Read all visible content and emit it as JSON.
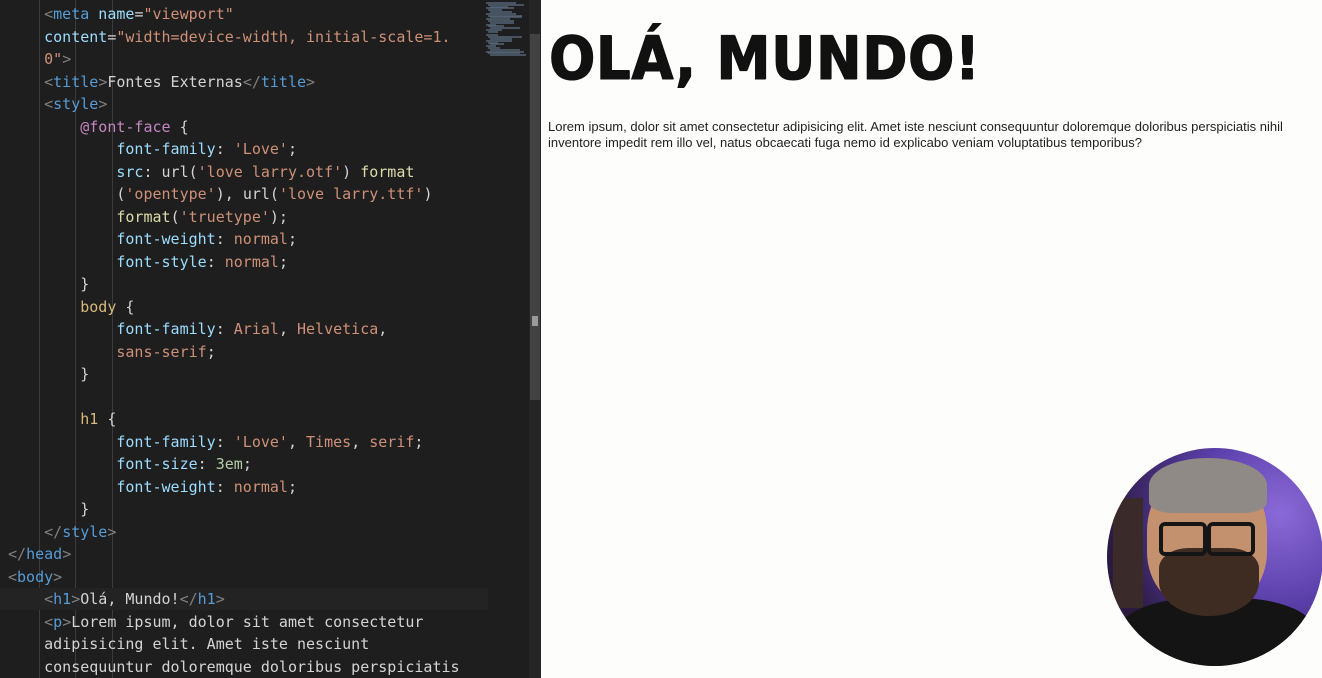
{
  "editor": {
    "lines": [
      [
        [
          "    ",
          "t-txt"
        ],
        [
          "<",
          "t-punc"
        ],
        [
          "meta",
          "t-tag"
        ],
        [
          " name",
          "t-attr"
        ],
        [
          "=",
          "t-txt"
        ],
        [
          "\"viewport\"",
          "t-str"
        ]
      ],
      [
        [
          "    ",
          "t-txt"
        ],
        [
          "content",
          "t-attr"
        ],
        [
          "=",
          "t-txt"
        ],
        [
          "\"width=device-width, initial-scale=1.",
          "t-str"
        ]
      ],
      [
        [
          "    ",
          "t-txt"
        ],
        [
          "0\"",
          "t-str"
        ],
        [
          ">",
          "t-punc"
        ]
      ],
      [
        [
          "    ",
          "t-txt"
        ],
        [
          "<",
          "t-punc"
        ],
        [
          "title",
          "t-tag"
        ],
        [
          ">",
          "t-punc"
        ],
        [
          "Fontes Externas",
          "t-txt"
        ],
        [
          "</",
          "t-punc"
        ],
        [
          "title",
          "t-tag"
        ],
        [
          ">",
          "t-punc"
        ]
      ],
      [
        [
          "    ",
          "t-txt"
        ],
        [
          "<",
          "t-punc"
        ],
        [
          "style",
          "t-tag"
        ],
        [
          ">",
          "t-punc"
        ]
      ],
      [
        [
          "        ",
          "t-txt"
        ],
        [
          "@font-face",
          "t-at"
        ],
        [
          " {",
          "t-txt"
        ]
      ],
      [
        [
          "            ",
          "t-txt"
        ],
        [
          "font-family",
          "t-prop"
        ],
        [
          ": ",
          "t-txt"
        ],
        [
          "'Love'",
          "t-str"
        ],
        [
          ";",
          "t-txt"
        ]
      ],
      [
        [
          "            ",
          "t-txt"
        ],
        [
          "src",
          "t-prop"
        ],
        [
          ": ",
          "t-txt"
        ],
        [
          "url(",
          "t-txt"
        ],
        [
          "'love larry.otf'",
          "t-str"
        ],
        [
          ") ",
          "t-txt"
        ],
        [
          "format",
          "t-fn"
        ]
      ],
      [
        [
          "            ",
          "t-txt"
        ],
        [
          "(",
          "t-txt"
        ],
        [
          "'opentype'",
          "t-str"
        ],
        [
          "), ",
          "t-txt"
        ],
        [
          "url(",
          "t-txt"
        ],
        [
          "'love larry.ttf'",
          "t-str"
        ],
        [
          ")",
          "t-txt"
        ]
      ],
      [
        [
          "            ",
          "t-txt"
        ],
        [
          "format",
          "t-fn"
        ],
        [
          "(",
          "t-txt"
        ],
        [
          "'truetype'",
          "t-str"
        ],
        [
          ");",
          "t-txt"
        ]
      ],
      [
        [
          "            ",
          "t-txt"
        ],
        [
          "font-weight",
          "t-prop"
        ],
        [
          ": ",
          "t-txt"
        ],
        [
          "normal",
          "t-str"
        ],
        [
          ";",
          "t-txt"
        ]
      ],
      [
        [
          "            ",
          "t-txt"
        ],
        [
          "font-style",
          "t-prop"
        ],
        [
          ": ",
          "t-txt"
        ],
        [
          "normal",
          "t-str"
        ],
        [
          ";",
          "t-txt"
        ]
      ],
      [
        [
          "        ",
          "t-txt"
        ],
        [
          "}",
          "t-txt"
        ]
      ],
      [
        [
          "        ",
          "t-txt"
        ],
        [
          "body",
          "t-sel"
        ],
        [
          " {",
          "t-txt"
        ]
      ],
      [
        [
          "            ",
          "t-txt"
        ],
        [
          "font-family",
          "t-prop"
        ],
        [
          ": ",
          "t-txt"
        ],
        [
          "Arial",
          "t-str"
        ],
        [
          ", ",
          "t-txt"
        ],
        [
          "Helvetica",
          "t-str"
        ],
        [
          ",",
          "t-txt"
        ]
      ],
      [
        [
          "            ",
          "t-txt"
        ],
        [
          "sans-serif",
          "t-str"
        ],
        [
          ";",
          "t-txt"
        ]
      ],
      [
        [
          "        ",
          "t-txt"
        ],
        [
          "}",
          "t-txt"
        ]
      ],
      [
        [
          "",
          "t-txt"
        ]
      ],
      [
        [
          "        ",
          "t-txt"
        ],
        [
          "h1",
          "t-sel"
        ],
        [
          " {",
          "t-txt"
        ]
      ],
      [
        [
          "            ",
          "t-txt"
        ],
        [
          "font-family",
          "t-prop"
        ],
        [
          ": ",
          "t-txt"
        ],
        [
          "'Love'",
          "t-str"
        ],
        [
          ", ",
          "t-txt"
        ],
        [
          "Times",
          "t-str"
        ],
        [
          ", ",
          "t-txt"
        ],
        [
          "serif",
          "t-str"
        ],
        [
          ";",
          "t-txt"
        ]
      ],
      [
        [
          "            ",
          "t-txt"
        ],
        [
          "font-size",
          "t-prop"
        ],
        [
          ": ",
          "t-txt"
        ],
        [
          "3em",
          "t-num"
        ],
        [
          ";",
          "t-txt"
        ]
      ],
      [
        [
          "            ",
          "t-txt"
        ],
        [
          "font-weight",
          "t-prop"
        ],
        [
          ": ",
          "t-txt"
        ],
        [
          "normal",
          "t-str"
        ],
        [
          ";",
          "t-txt"
        ]
      ],
      [
        [
          "        ",
          "t-txt"
        ],
        [
          "}",
          "t-txt"
        ]
      ],
      [
        [
          "    ",
          "t-txt"
        ],
        [
          "</",
          "t-punc"
        ],
        [
          "style",
          "t-tag"
        ],
        [
          ">",
          "t-punc"
        ]
      ],
      [
        [
          "",
          "t-txt"
        ],
        [
          "</",
          "t-punc"
        ],
        [
          "head",
          "t-tag"
        ],
        [
          ">",
          "t-punc"
        ]
      ],
      [
        [
          "",
          "t-txt"
        ],
        [
          "<",
          "t-punc"
        ],
        [
          "body",
          "t-tag"
        ],
        [
          ">",
          "t-punc"
        ]
      ],
      [
        [
          "    ",
          "t-txt"
        ],
        [
          "<",
          "t-punc"
        ],
        [
          "h1",
          "t-tag"
        ],
        [
          ">",
          "t-punc"
        ],
        [
          "Olá, Mundo!",
          "t-txt"
        ],
        [
          "</",
          "t-punc"
        ],
        [
          "h1",
          "t-tag"
        ],
        [
          ">",
          "t-punc"
        ]
      ],
      [
        [
          "    ",
          "t-txt"
        ],
        [
          "<",
          "t-punc"
        ],
        [
          "p",
          "t-tag"
        ],
        [
          ">",
          "t-punc"
        ],
        [
          "Lorem ipsum, dolor sit amet consectetur",
          "t-txt"
        ]
      ],
      [
        [
          "    ",
          "t-txt"
        ],
        [
          "adipisicing elit. Amet iste nesciunt",
          "t-txt"
        ]
      ],
      [
        [
          "    ",
          "t-txt"
        ],
        [
          "consequuntur doloremque doloribus perspiciatis",
          "t-txt"
        ]
      ]
    ],
    "current_line": 26
  },
  "preview": {
    "heading": "OLÁ, MUNDO!",
    "paragraph": "Lorem ipsum, dolor sit amet consectetur adipisicing elit. Amet iste nesciunt consequuntur doloremque doloribus perspiciatis nihil inventore impedit rem illo vel, natus obcaecati fuga nemo id explicabo veniam voluptatibus temporibus?"
  }
}
